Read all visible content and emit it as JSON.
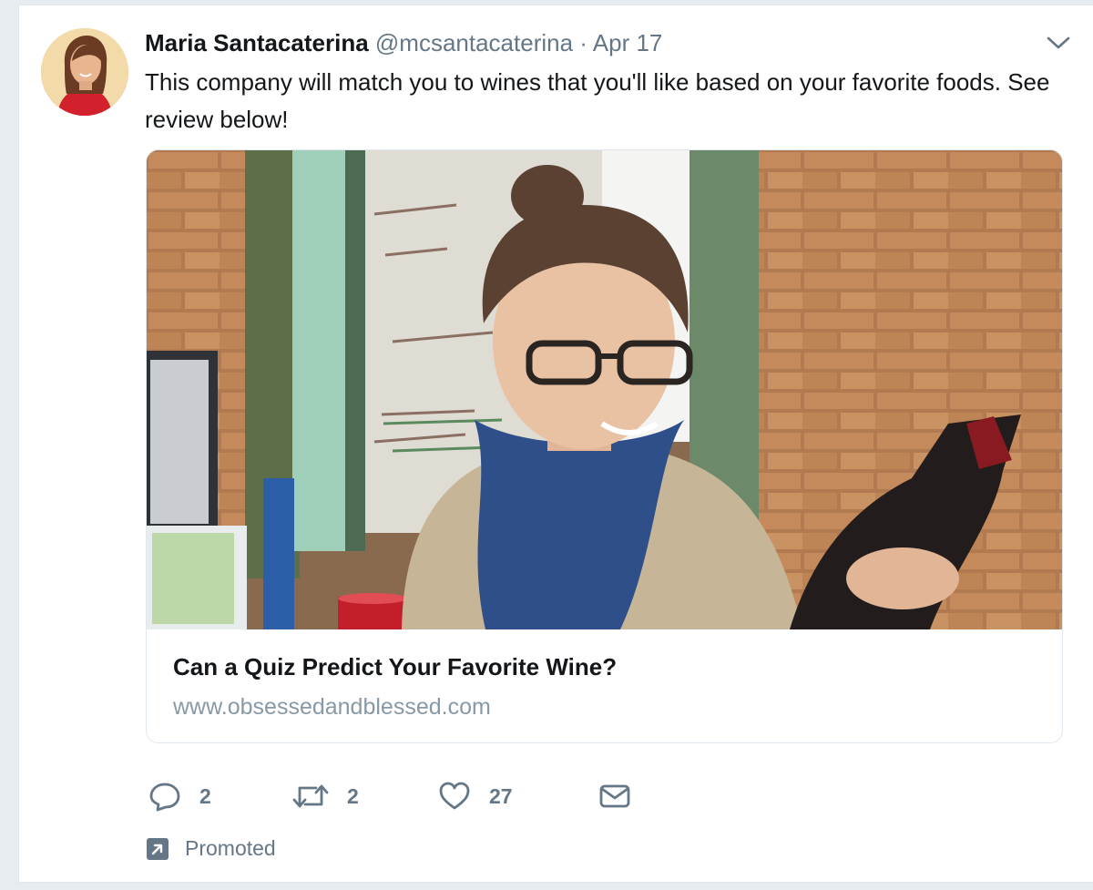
{
  "tweet": {
    "author_name": "Maria Santacaterina",
    "author_handle": "@mcsantacaterina",
    "separator": "·",
    "date": "Apr 17",
    "text": "This company will match you to wines that you'll like based on your favorite foods. See review below!",
    "avatar_icon": "user-avatar"
  },
  "card": {
    "title": "Can a Quiz Predict Your Favorite Wine?",
    "url": "www.obsessedandblessed.com",
    "image_icon": "photo-woman-holding-wine-bottle"
  },
  "actions": {
    "reply_count": "2",
    "retweet_count": "2",
    "like_count": "27",
    "reply_icon": "reply-icon",
    "retweet_icon": "retweet-icon",
    "like_icon": "heart-icon",
    "dm_icon": "envelope-icon"
  },
  "promoted": {
    "label": "Promoted",
    "icon": "promoted-arrow-icon"
  },
  "colors": {
    "text_primary": "#14171a",
    "text_secondary": "#657786",
    "url_gray": "#8899a6",
    "border": "#e1e8ed",
    "background": "#e6ecf0"
  }
}
